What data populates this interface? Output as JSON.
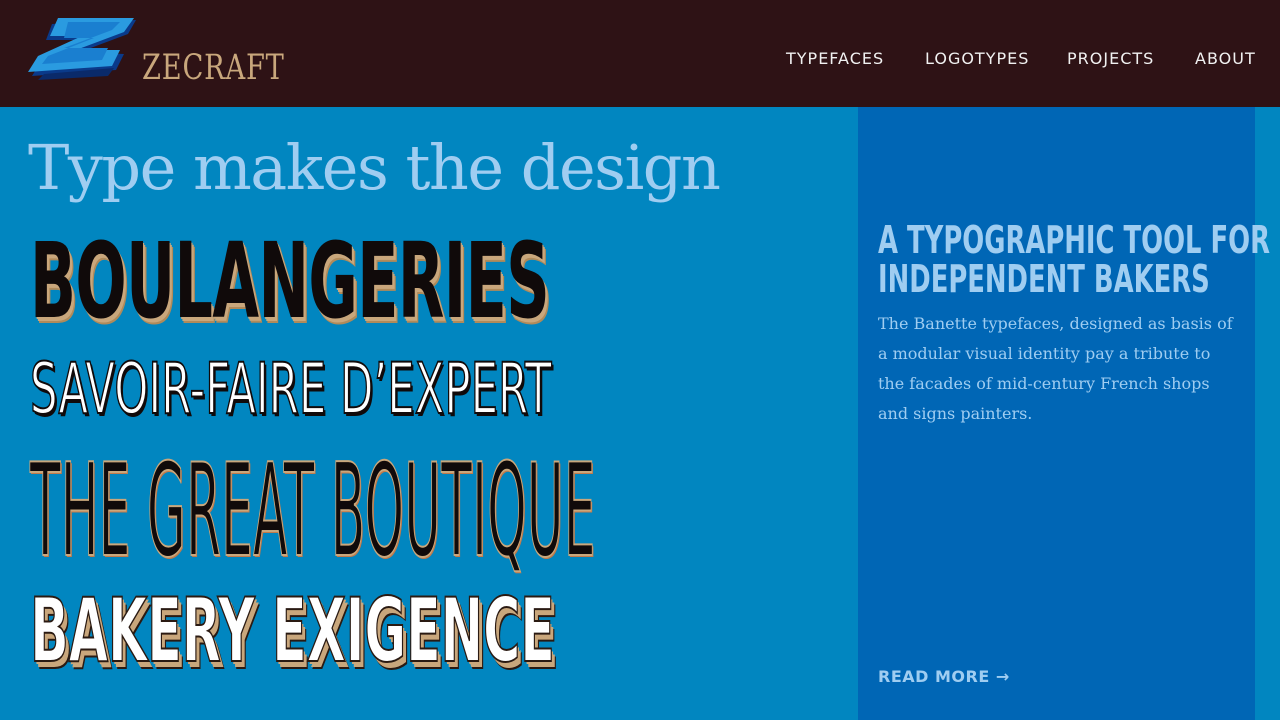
{
  "brand": {
    "name": "ZECRAFT",
    "colors": {
      "header_bg": "#2e1215",
      "hero_bg": "#0186c0",
      "panel_bg": "#0066b5",
      "accent_gold": "#c9a77c",
      "text_light": "#9fcdf1"
    }
  },
  "nav": {
    "items": [
      "TYPEFACES",
      "LOGOTYPES",
      "PROJECTS",
      "ABOUT"
    ]
  },
  "hero": {
    "tagline": "Type makes the design",
    "specimens": [
      "BOULANGERIES",
      "SAVOIR-FAIRE D’EXPERT",
      "THE GREAT BOUTIQUE",
      "BAKERY EXIGENCE"
    ]
  },
  "panel": {
    "heading_lines": [
      "A TYPOGRAPHIC TOOL FOR",
      "INDEPENDENT BAKERS"
    ],
    "body_lines": [
      "The Banette typefaces, designed as basis of",
      "a modular visual identity pay a tribute to",
      "the facades of mid-century French shops",
      "and signs painters."
    ],
    "read_more": "READ MORE →"
  },
  "icons": {
    "logo": "zecraft-z-logo-icon"
  }
}
